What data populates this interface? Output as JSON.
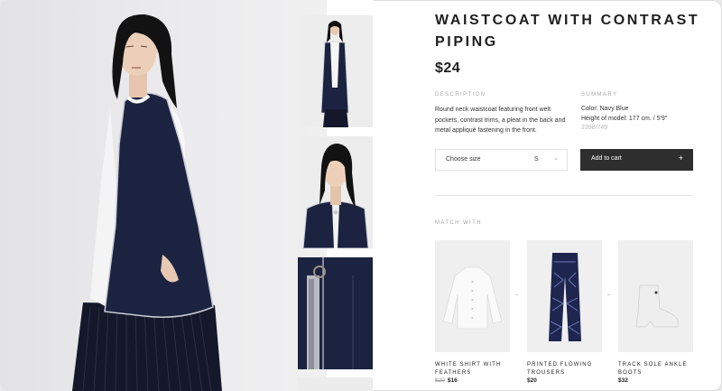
{
  "product": {
    "title": "WAISTCOAT WITH CONTRAST PIPING",
    "price": "$24",
    "description_label": "DESCRIPTION",
    "description": "Round neck waistcoat featuring front welt pockets, contrast trims, a pleat in the back and metal appliqué fastening in the front.",
    "summary_label": "SUMMARY",
    "summary_color": "Color: Navy Blue",
    "summary_height": "Height of model: 177 cm. / 5′9″",
    "summary_ref": "2398/749"
  },
  "actions": {
    "size_placeholder": "Choose size",
    "size_value": "S",
    "add_to_cart": "Add to cart",
    "add_icon": "+"
  },
  "match": {
    "label": "MATCH WITH",
    "items": [
      {
        "name": "WHITE SHIRT WITH FEATHERS",
        "old_price": "$20",
        "price": "$16"
      },
      {
        "name": "PRINTED FLOWING TROUSERS",
        "old_price": "",
        "price": "$20"
      },
      {
        "name": "TRACK SOLE ANKLE BOOTS",
        "old_price": "",
        "price": "$32"
      }
    ],
    "separator": "–"
  },
  "icons": {
    "chevron": "chevron-down-icon",
    "plus": "plus-icon"
  },
  "colors": {
    "navy": "#1c2340",
    "button": "#2e2e2e",
    "muted": "#a7a7a7"
  }
}
